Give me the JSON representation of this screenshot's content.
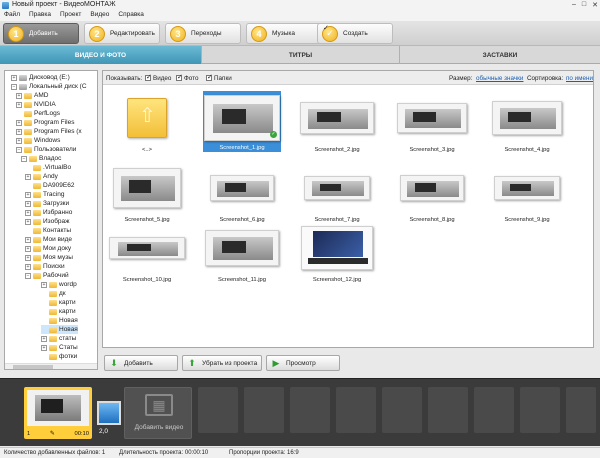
{
  "window": {
    "title": "Новый проект - ВидеоМОНТАЖ"
  },
  "menu": [
    "Файл",
    "Правка",
    "Проект",
    "Видео",
    "Справка"
  ],
  "steps": [
    {
      "num": "1",
      "label": "Добавить",
      "active": true
    },
    {
      "num": "2",
      "label": "Редактировать",
      "active": false
    },
    {
      "num": "3",
      "label": "Переходы",
      "active": false
    },
    {
      "num": "4",
      "label": "Музыка",
      "active": false
    },
    {
      "num": "✓",
      "label": "Создать",
      "active": false
    }
  ],
  "subtabs": [
    "ВИДЕО И ФОТО",
    "ТИТРЫ",
    "ЗАСТАВКИ"
  ],
  "tree": [
    {
      "label": "Дисковод (E:)",
      "level": 1,
      "kind": "drive",
      "exp": "+"
    },
    {
      "label": "Локальный диск (C",
      "level": 1,
      "kind": "drive",
      "exp": "−"
    },
    {
      "label": "AMD",
      "level": 2,
      "kind": "folder",
      "exp": "+"
    },
    {
      "label": "NVIDIA",
      "level": 2,
      "kind": "folder",
      "exp": "+"
    },
    {
      "label": "PerfLogs",
      "level": 2,
      "kind": "folder",
      "exp": ""
    },
    {
      "label": "Program Files",
      "level": 2,
      "kind": "folder",
      "exp": "+"
    },
    {
      "label": "Program Files (x",
      "level": 2,
      "kind": "folder",
      "exp": "+"
    },
    {
      "label": "Windows",
      "level": 2,
      "kind": "folder",
      "exp": "+"
    },
    {
      "label": "Пользователи",
      "level": 2,
      "kind": "folder",
      "exp": "−"
    },
    {
      "label": "Владос",
      "level": 3,
      "kind": "folder",
      "exp": "−"
    },
    {
      "label": ".VirtualBo",
      "level": 4,
      "kind": "folder",
      "exp": ""
    },
    {
      "label": "Andy",
      "level": 4,
      "kind": "folder",
      "exp": "+"
    },
    {
      "label": "DA909E62",
      "level": 4,
      "kind": "folder",
      "exp": ""
    },
    {
      "label": "Tracing",
      "level": 4,
      "kind": "folder",
      "exp": "+"
    },
    {
      "label": "Загрузки",
      "level": 4,
      "kind": "folder",
      "exp": "+"
    },
    {
      "label": "Избранно",
      "level": 4,
      "kind": "folder",
      "exp": "+"
    },
    {
      "label": "Изображ",
      "level": 4,
      "kind": "folder",
      "exp": "+"
    },
    {
      "label": "Контакты",
      "level": 4,
      "kind": "folder",
      "exp": ""
    },
    {
      "label": "Мои виде",
      "level": 4,
      "kind": "folder",
      "exp": "+"
    },
    {
      "label": "Мои доку",
      "level": 4,
      "kind": "folder",
      "exp": "+"
    },
    {
      "label": "Моя музы",
      "level": 4,
      "kind": "folder",
      "exp": "+"
    },
    {
      "label": "Поиски",
      "level": 4,
      "kind": "folder",
      "exp": "+"
    },
    {
      "label": "Рабочий",
      "level": 4,
      "kind": "folder",
      "exp": "−"
    },
    {
      "label": "wordp",
      "level": 5,
      "kind": "folder",
      "exp": "+"
    },
    {
      "label": "дк",
      "level": 5,
      "kind": "folder",
      "exp": ""
    },
    {
      "label": "карти",
      "level": 5,
      "kind": "folder",
      "exp": ""
    },
    {
      "label": "карти",
      "level": 5,
      "kind": "folder",
      "exp": ""
    },
    {
      "label": "Новая",
      "level": 5,
      "kind": "folder",
      "exp": ""
    },
    {
      "label": "Новая",
      "level": 5,
      "kind": "folder",
      "exp": "",
      "selected": true
    },
    {
      "label": "статы",
      "level": 5,
      "kind": "folder",
      "exp": "+"
    },
    {
      "label": "Статы",
      "level": 5,
      "kind": "folder",
      "exp": "+"
    },
    {
      "label": "фотки",
      "level": 5,
      "kind": "folder",
      "exp": ""
    },
    {
      "label": "ярлык",
      "level": 5,
      "kind": "folder",
      "exp": ""
    }
  ],
  "filter": {
    "show_label": "Показывать:",
    "video": "Видео",
    "photo": "Фото",
    "folders": "Папки",
    "size_label": "Размер:",
    "size_value": "обычные значки",
    "sort_label": "Сортировка:",
    "sort_value": "по имени"
  },
  "files": [
    {
      "name": "<..>",
      "kind": "up"
    },
    {
      "name": "Screenshot_1.jpg",
      "kind": "pc",
      "selected": true
    },
    {
      "name": "Screenshot_2.jpg",
      "kind": "pc"
    },
    {
      "name": "Screenshot_3.jpg",
      "kind": "pc"
    },
    {
      "name": "Screenshot_4.jpg",
      "kind": "pc"
    },
    {
      "name": "Screenshot_5.jpg",
      "kind": "pc"
    },
    {
      "name": "Screenshot_6.jpg",
      "kind": "pc"
    },
    {
      "name": "Screenshot_7.jpg",
      "kind": "pc"
    },
    {
      "name": "Screenshot_8.jpg",
      "kind": "pc"
    },
    {
      "name": "Screenshot_9.jpg",
      "kind": "pc"
    },
    {
      "name": "Screenshot_10.jpg",
      "kind": "pc"
    },
    {
      "name": "Screenshot_11.jpg",
      "kind": "pc"
    },
    {
      "name": "Screenshot_12.jpg",
      "kind": "laptop"
    }
  ],
  "buttons": {
    "add": "Добавить",
    "remove": "Убрать из проекта",
    "preview": "Просмотр"
  },
  "timeline": {
    "clip_index": "1",
    "clip_duration": "00:10",
    "transition_duration": "2,0",
    "add_video": "Добавить видео"
  },
  "status": {
    "count": "Количество добавленных файлов: 1",
    "duration": "Длительность проекта: 00:00:10",
    "ratio": "Пропорции проекта: 16:9"
  },
  "colors": {
    "accent": "#3f96b6",
    "step_badge": "#f0b21d",
    "selection": "#3b8fd8",
    "clip": "#ffce3a"
  }
}
